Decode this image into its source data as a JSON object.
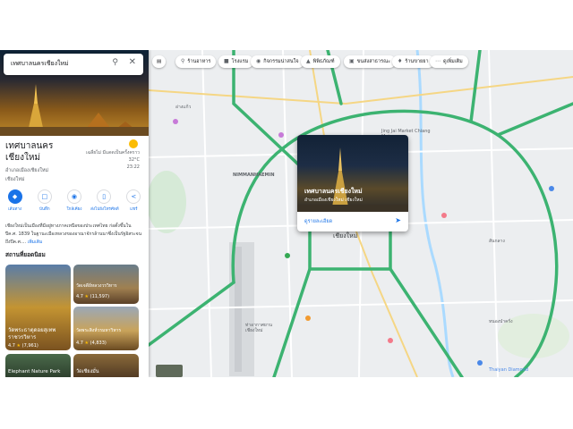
{
  "search": {
    "value": "เทศบาลนครเชียงใหม่",
    "icon_search": "search-icon",
    "icon_close": "close-icon"
  },
  "place": {
    "title_line1": "เทศบาลนคร",
    "title_line2": "เชียงใหม่",
    "sub_line1": "อำเภอเมืองเชียงใหม่",
    "sub_line2": "เชียงใหม่",
    "weather_desc": "เฉลี่ยไม่ มีแดดเป็นครั้งคราว",
    "weather_temp": "32°C",
    "weather_time": "23:22"
  },
  "actions": [
    {
      "icon": "directions-icon",
      "label": "เส้นทาง"
    },
    {
      "icon": "bookmark-icon",
      "label": "บันทึก"
    },
    {
      "icon": "nearby-icon",
      "label": "ใกล้เคียง"
    },
    {
      "icon": "phone-icon",
      "label": "ส่งไปยังโทรศัพท์"
    },
    {
      "icon": "share-icon",
      "label": "แชร์"
    }
  ],
  "description": "เชียงใหม่เป็นเมืองที่มีอยู่ทางภาคเหนือของประเทศไทย ก่อตั้งขึ้นในปีค.ศ. 1839 ในฐานะเมืองหลวงของอาณาจักรล้านนาซึ่งเป็นรัฐอิสระจนถึงปีค.ศ....",
  "description_more": "เพิ่มเติม",
  "section_title": "สถานที่ยอดนิยม",
  "cards": [
    {
      "title": "วัดพระธาตุดอยสุเทพราชวรวิหาร",
      "rating": "4.7",
      "reviews": "(7,961)"
    },
    {
      "title": "วัดเจดีย์หลวงวรวิหาร",
      "rating": "4.7",
      "reviews": "(11,597)"
    },
    {
      "title": "วัดพระสิงห์วรมหาวิหาร",
      "rating": "4.7",
      "reviews": "(4,833)"
    },
    {
      "title": "Elephant Nature Park",
      "rating": "",
      "reviews": ""
    },
    {
      "title": "วัดเชียงมั่น",
      "rating": "",
      "reviews": ""
    }
  ],
  "chips": [
    {
      "icon": "restaurant-icon",
      "label": "ร้านอาหาร"
    },
    {
      "icon": "hotel-icon",
      "label": "โรงแรม"
    },
    {
      "icon": "camera-icon",
      "label": "กิจกรรมน่าสนใจ"
    },
    {
      "icon": "museum-icon",
      "label": "พิพิธภัณฑ์"
    },
    {
      "icon": "transit-icon",
      "label": "ขนส่งสาธารณะ"
    },
    {
      "icon": "pharmacy-icon",
      "label": "ร้านขายยา"
    },
    {
      "icon": "more-icon",
      "label": "ดูเพิ่มเติม"
    }
  ],
  "popup": {
    "title": "เทศบาลนครเชียงใหม่",
    "subtitle": "อำเภอเมืองเชียงใหม่ เชียงใหม่",
    "link": "ดูรายละเอียด"
  },
  "map_labels": {
    "nimman": "NIMMANHAEMIN",
    "chiangmai": "เชียงใหม่",
    "jingjai": "Jing Jai Market Chiang Mai",
    "sanklang": "สันกลาง",
    "thaiyan": "Thaiyan Diamond",
    "airport": "ท่าอากาศยาน เชียงใหม่",
    "lake": "อ่างแก้ว",
    "nongpa": "หนองป่าครั่ง"
  },
  "colors": {
    "accent": "#1a73e8",
    "road": "#3cb371",
    "water": "#aadaff"
  }
}
